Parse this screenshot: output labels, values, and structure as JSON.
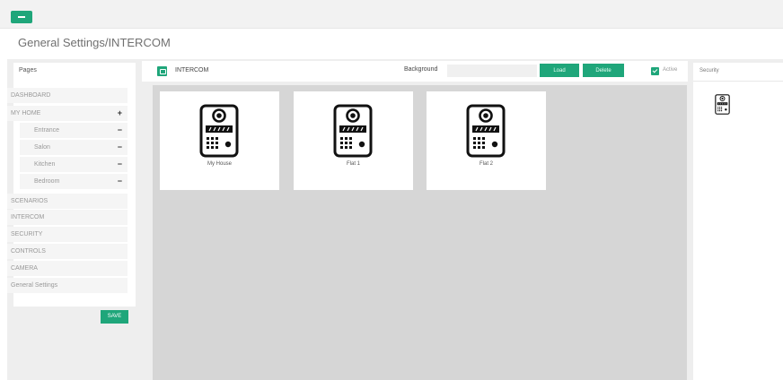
{
  "header": {
    "title": "General Settings/INTERCOM"
  },
  "pages_panel": {
    "title": "Pages",
    "items": [
      {
        "label": "DASHBOARD",
        "symbol": ""
      },
      {
        "label": "MY HOME",
        "symbol": "+"
      },
      {
        "label": "Entrance",
        "symbol": "−"
      },
      {
        "label": "Salon",
        "symbol": "−"
      },
      {
        "label": "Kitchen",
        "symbol": "−"
      },
      {
        "label": "Bedroom",
        "symbol": "−"
      },
      {
        "label": "SCENARIOS",
        "symbol": ""
      },
      {
        "label": "INTERCOM",
        "symbol": ""
      },
      {
        "label": "SECURITY",
        "symbol": ""
      },
      {
        "label": "CONTROLS",
        "symbol": ""
      },
      {
        "label": "CAMERA",
        "symbol": ""
      },
      {
        "label": "General Settings",
        "symbol": ""
      }
    ],
    "save_label": "SAVE"
  },
  "editor": {
    "title": "INTERCOM",
    "background_label": "Background",
    "background_value": "",
    "load_label": "Load",
    "delete_label": "Delete",
    "active_label": "Active",
    "active_checked": true
  },
  "devices": [
    {
      "label": "My House",
      "icon": "intercom-doorphone-icon"
    },
    {
      "label": "Flat 1",
      "icon": "intercom-doorphone-icon"
    },
    {
      "label": "Flat 2",
      "icon": "intercom-doorphone-icon"
    }
  ],
  "security_panel": {
    "title": "Security",
    "icon": "intercom-doorphone-icon"
  },
  "colors": {
    "accent": "#1fa67a",
    "canvas": "#d6d6d6",
    "panel_bg": "#eeeeee"
  }
}
